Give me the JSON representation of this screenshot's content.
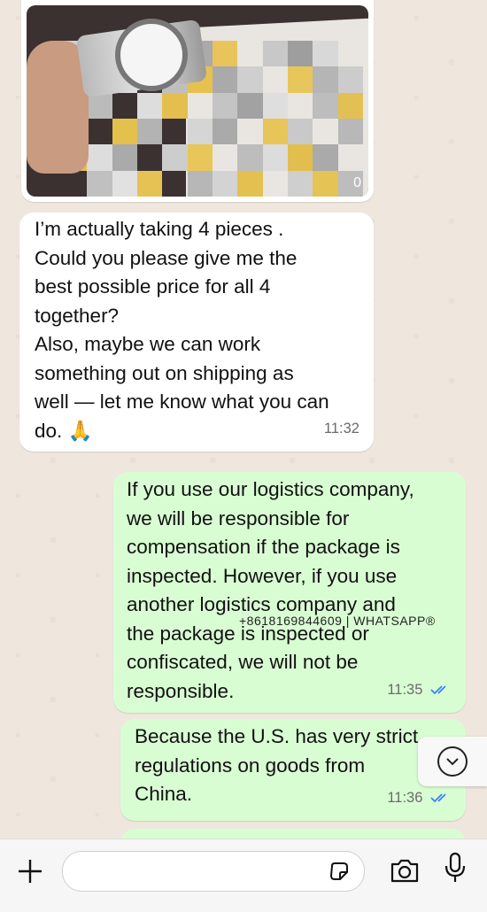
{
  "image_message": {
    "counter": "0"
  },
  "messages": [
    {
      "direction": "incoming",
      "text": "I’m actually taking 4 pieces .\nCould you please give me the\nbest possible price for all 4\ntogether?\nAlso, maybe we can work\nsomething out on shipping as\nwell — let me know what you can\ndo. 🙏",
      "time": "11:32"
    },
    {
      "direction": "outgoing",
      "text": "If you use our logistics company,\nwe will be responsible for\ncompensation if the package is\ninspected. However, if you use\nanother logistics company and\nthe package is inspected or\nconfiscated, we will not be\nresponsible.",
      "time": "11:35",
      "status": "read"
    },
    {
      "direction": "outgoing",
      "text": "Because the U.S. has very strict\nregulations on goods from\nChina.",
      "time": "11:36",
      "status": "read"
    }
  ],
  "watermark": "+8618169844609 | WHATSAPP®",
  "composer": {
    "placeholder": ""
  },
  "colors": {
    "incoming": "#ffffff",
    "outgoing": "#d9fdd3",
    "tick_read": "#3b82f6",
    "wallpaper": "#efe7dd"
  },
  "icons": [
    "plus-icon",
    "sticker-icon",
    "camera-icon",
    "microphone-icon",
    "chevron-down-icon",
    "double-check-icon"
  ]
}
